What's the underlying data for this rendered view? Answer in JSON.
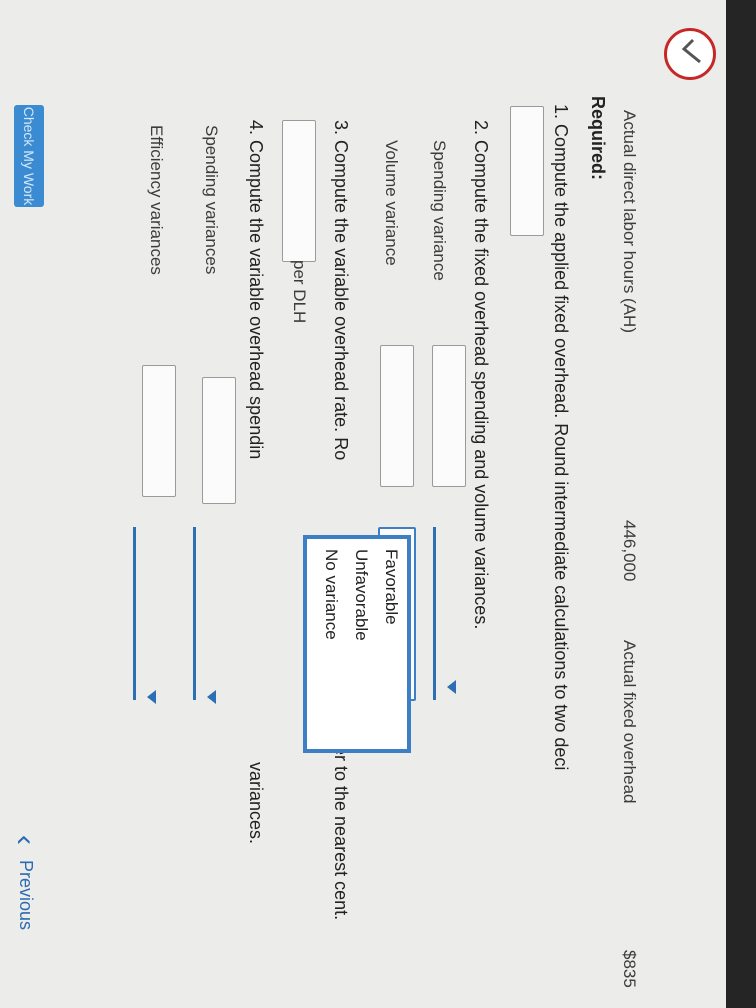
{
  "header": {
    "ah_label": "Actual direct labor hours (AH)",
    "ah_value": "446,000",
    "fixed_label": "Actual fixed overhead",
    "fixed_value": "$835"
  },
  "required": "Required:",
  "q1": {
    "text": "1. Compute the applied fixed overhead. Round intermediate calculations to two deci",
    "dollar": "$"
  },
  "q2": {
    "text": "2. Compute the fixed overhead spending and volume variances.",
    "spending_label": "Spending variance",
    "volume_label": "Volume variance",
    "dollar": "$"
  },
  "q3": {
    "text": "3. Compute the variable overhead rate. Ro",
    "text_tail": "er to the nearest cent.",
    "dollar": "$",
    "unit": "per DLH"
  },
  "q4": {
    "text": "4. Compute the variable overhead spendin",
    "text_tail": "variances.",
    "spending_label": "Spending variances",
    "efficiency_label": "Efficiency variances",
    "dollar": "$"
  },
  "dropdown": {
    "options": [
      "Favorable",
      "Unfavorable",
      "No variance"
    ]
  },
  "buttons": {
    "check": "Check My Work",
    "previous": "Previous"
  },
  "colors": {
    "accent": "#2d6fb4",
    "check_ring": "#c62828"
  }
}
